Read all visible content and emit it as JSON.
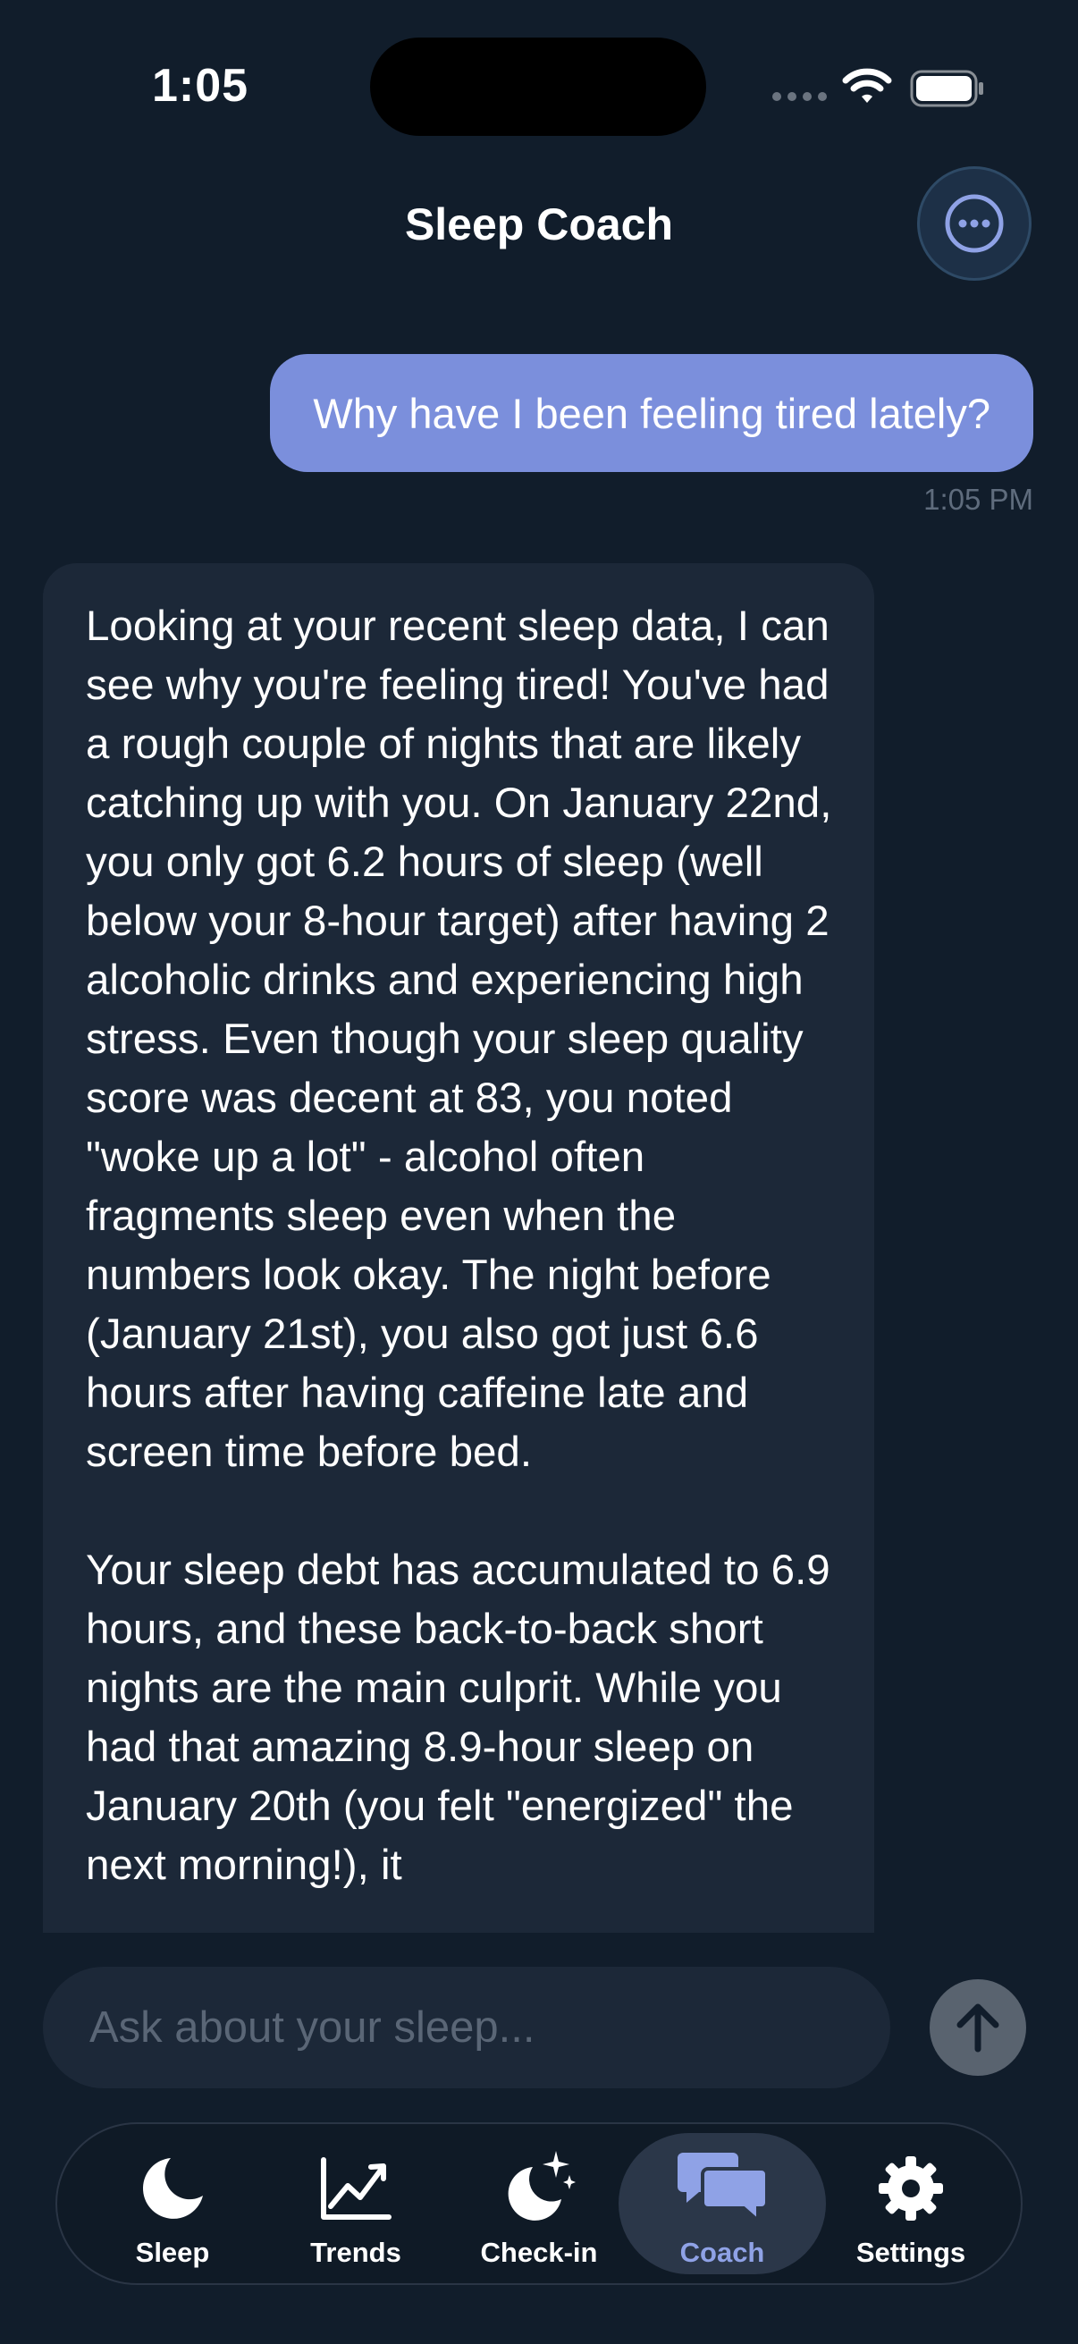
{
  "status_bar": {
    "time": "1:05"
  },
  "header": {
    "title": "Sleep Coach",
    "more_icon": "ellipsis-circle-icon"
  },
  "messages": [
    {
      "role": "user",
      "text": "Why have I been feeling tired lately?",
      "time": "1:05 PM"
    },
    {
      "role": "assistant",
      "paragraphs": [
        "Looking at your recent sleep data, I can see why you're feeling tired! You've had a rough couple of nights that are likely catching up with you. On January 22nd, you only got 6.2 hours of sleep (well below your 8-hour target) after having 2 alcoholic drinks and experiencing high stress. Even though your sleep quality score was decent at 83, you noted \"woke up a lot\" - alcohol often fragments sleep even when the numbers look okay. The night before (January 21st), you also got just 6.6 hours after having caffeine late and screen time before bed.",
        "Your sleep debt has accumulated to 6.9 hours, and these back-to-back short nights are the main culprit. While you had that amazing 8.9-hour sleep on January 20th (you felt \"energized\" the next morning!), it"
      ]
    }
  ],
  "composer": {
    "placeholder": "Ask about your sleep...",
    "send_icon": "arrow-up-icon"
  },
  "tabs": [
    {
      "label": "Sleep",
      "icon": "moon-icon"
    },
    {
      "label": "Trends",
      "icon": "chart-line-icon"
    },
    {
      "label": "Check-in",
      "icon": "moon-stars-icon"
    },
    {
      "label": "Coach",
      "icon": "chat-bubbles-icon",
      "active": true
    },
    {
      "label": "Settings",
      "icon": "gear-icon"
    }
  ],
  "colors": {
    "background": "#111d2b",
    "user_bubble": "#7b8fdc",
    "assistant_bubble": "#1c2838",
    "accent": "#8fa2e6"
  }
}
